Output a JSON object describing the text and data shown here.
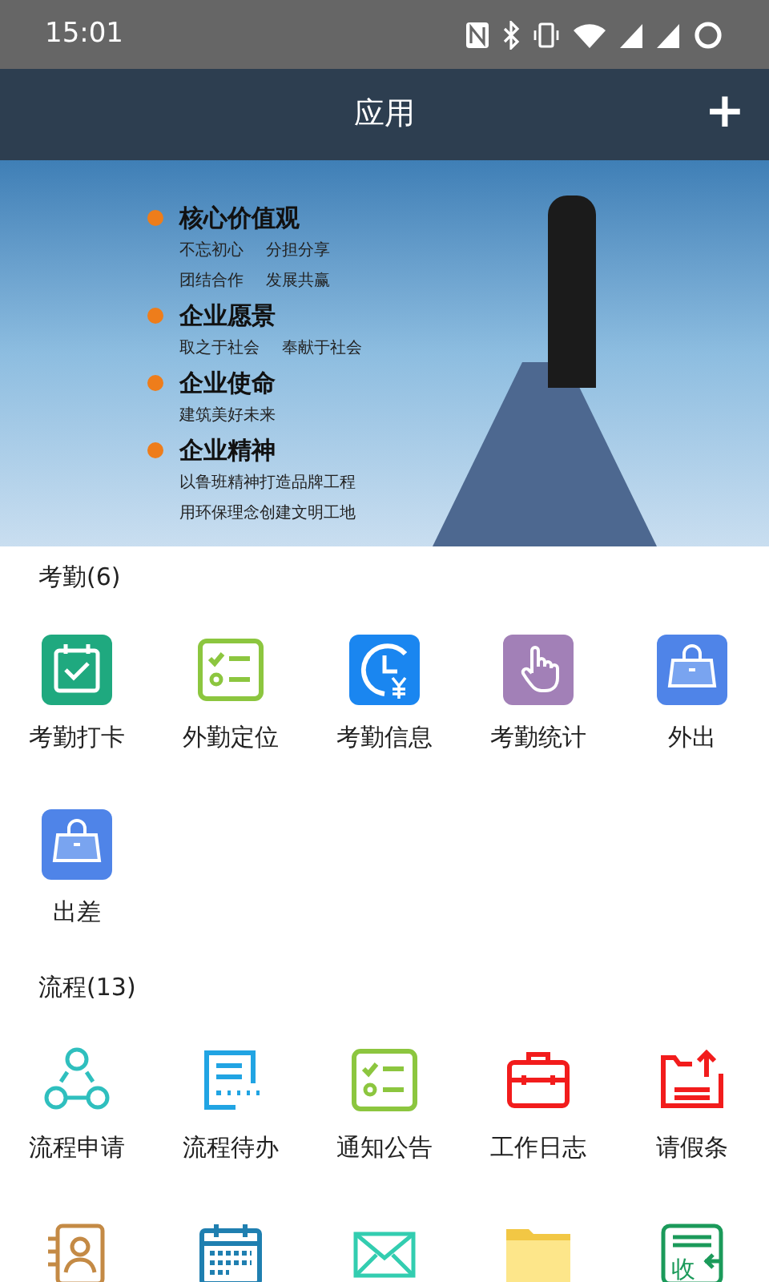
{
  "status_bar": {
    "time": "15:01"
  },
  "header": {
    "title": "应用",
    "action": "+"
  },
  "banner": {
    "sections": [
      {
        "heading": "核心价值观",
        "lines": [
          [
            "不忘初心",
            "分担分享"
          ],
          [
            "团结合作",
            "发展共赢"
          ]
        ]
      },
      {
        "heading": "企业愿景",
        "lines": [
          [
            "取之于社会",
            "奉献于社会"
          ]
        ]
      },
      {
        "heading": "企业使命",
        "lines": [
          [
            "建筑美好未来"
          ]
        ]
      },
      {
        "heading": "企业精神",
        "lines": [
          [
            "以鲁班精神打造品牌工程"
          ],
          [
            "用环保理念创建文明工地"
          ]
        ]
      }
    ]
  },
  "groups": [
    {
      "title": "考勤(6)",
      "apps": [
        {
          "kind": "calendar-check",
          "label": "考勤打卡"
        },
        {
          "kind": "checklist-green",
          "label": "外勤定位"
        },
        {
          "kind": "clock-yen",
          "label": "考勤信息"
        },
        {
          "kind": "hand",
          "label": "考勤统计"
        },
        {
          "kind": "bag",
          "label": "外出"
        },
        {
          "kind": "bag",
          "label": "出差"
        }
      ]
    },
    {
      "title": "流程(13)",
      "apps": [
        {
          "kind": "flow",
          "label": "流程申请"
        },
        {
          "kind": "document",
          "label": "流程待办"
        },
        {
          "kind": "checklist-green",
          "label": "通知公告"
        },
        {
          "kind": "briefcase",
          "label": "工作日志"
        },
        {
          "kind": "tray-up",
          "label": "请假条"
        },
        {
          "kind": "contact"
        },
        {
          "kind": "calendar-grid"
        },
        {
          "kind": "mail"
        },
        {
          "kind": "folder"
        },
        {
          "kind": "receive",
          "icon_text": "收"
        }
      ]
    }
  ]
}
